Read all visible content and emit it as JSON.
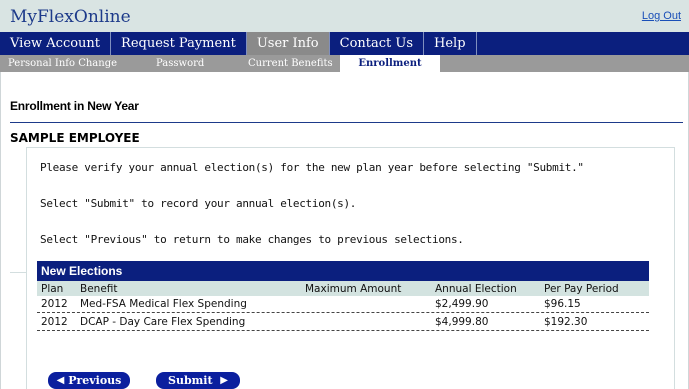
{
  "header": {
    "brand": "MyFlexOnline",
    "logout_label": "Log Out"
  },
  "main_nav": [
    {
      "label": "View Account",
      "active": false
    },
    {
      "label": "Request Payment",
      "active": false
    },
    {
      "label": "User Info",
      "active": true
    },
    {
      "label": "Contact Us",
      "active": false
    },
    {
      "label": "Help",
      "active": false
    }
  ],
  "sub_nav": [
    {
      "label": "Personal Info Change",
      "active": false
    },
    {
      "label": "Password",
      "active": false
    },
    {
      "label": "Current Benefits",
      "active": false
    },
    {
      "label": "Enrollment",
      "active": true
    }
  ],
  "page": {
    "section_title": "Enrollment in New Year",
    "employee_name": "SAMPLE EMPLOYEE",
    "messages": [
      "Please verify your annual election(s) for the new plan year before selecting \"Submit.\"",
      "Select \"Submit\" to record your annual election(s).",
      "Select \"Previous\" to return to make changes to previous selections."
    ]
  },
  "elections": {
    "title": "New Elections",
    "columns": [
      "Plan",
      "Benefit",
      "Maximum Amount",
      "Annual Election",
      "Per Pay Period"
    ],
    "rows": [
      {
        "plan": "2012",
        "benefit": "Med-FSA Medical Flex Spending",
        "maximum": "",
        "annual": "$2,499.90",
        "per_pay": "$96.15"
      },
      {
        "plan": "2012",
        "benefit": "DCAP - Day Care Flex Spending",
        "maximum": "",
        "annual": "$4,999.80",
        "per_pay": "$192.30"
      }
    ]
  },
  "buttons": {
    "previous_label": "Previous",
    "previous_icon": "triangle-left-icon",
    "submit_label": "Submit",
    "submit_icon": "triangle-right-icon"
  },
  "colors": {
    "nav_blue": "#0b1f7e",
    "header_bg": "#d9e4e3",
    "subnav_gray": "#9a9a9a",
    "table_header_bg": "#d3e3e0"
  }
}
